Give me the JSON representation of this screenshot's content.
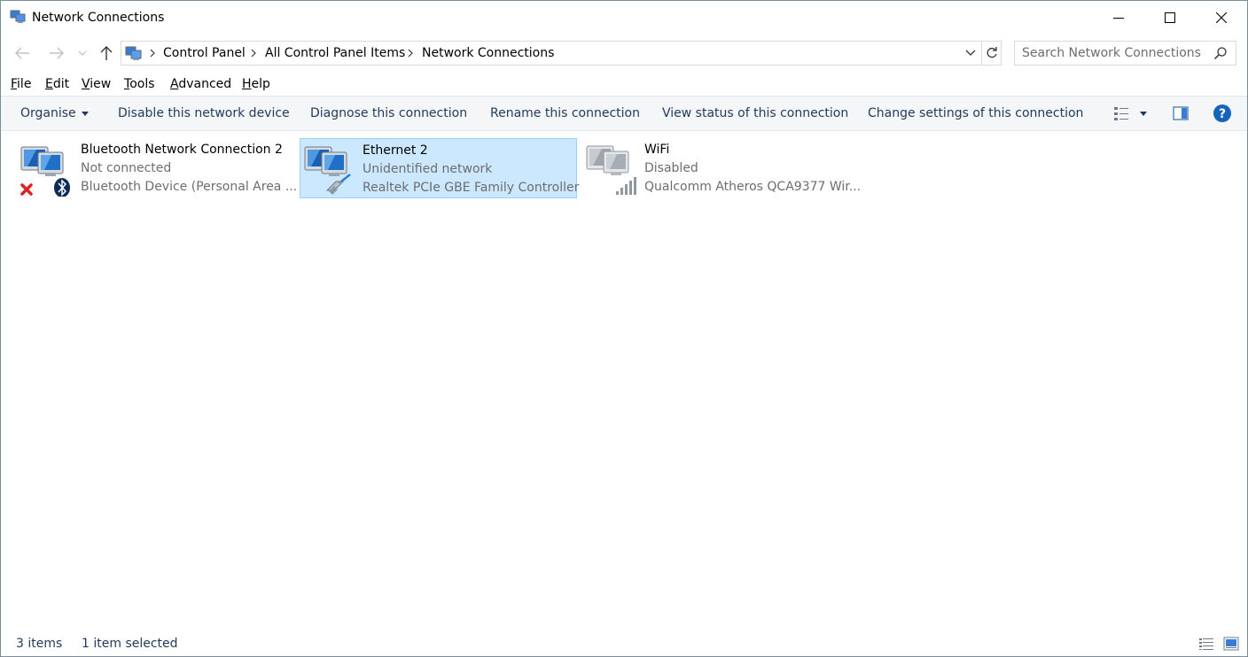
{
  "window": {
    "title": "Network Connections",
    "icon": "network-connections-icon"
  },
  "address": {
    "crumbs": [
      "Control Panel",
      "All Control Panel Items",
      "Network Connections"
    ]
  },
  "search": {
    "placeholder": "Search Network Connections"
  },
  "menu": {
    "items": [
      {
        "label": "File",
        "accel": "F",
        "rest": "ile"
      },
      {
        "label": "Edit",
        "accel": "E",
        "rest": "dit"
      },
      {
        "label": "View",
        "accel": "V",
        "rest": "iew"
      },
      {
        "label": "Tools",
        "accel": "T",
        "rest": "ools"
      },
      {
        "label": "Advanced",
        "accel": "A",
        "rest": "dvanced"
      },
      {
        "label": "Help",
        "accel": "H",
        "rest": "elp"
      }
    ]
  },
  "commands": {
    "organise": "Organise",
    "disable": "Disable this network device",
    "diagnose": "Diagnose this connection",
    "rename": "Rename this connection",
    "view_status": "View status of this connection",
    "change_settings": "Change settings of this connection"
  },
  "connections": [
    {
      "name": "Bluetooth Network Connection 2",
      "status": "Not connected",
      "device": "Bluetooth Device (Personal Area ...",
      "selected": false,
      "icon": "bluetooth-connection-icon"
    },
    {
      "name": "Ethernet 2",
      "status": "Unidentified network",
      "device": "Realtek PCIe GBE Family Controller",
      "selected": true,
      "icon": "ethernet-connection-icon"
    },
    {
      "name": "WiFi",
      "status": "Disabled",
      "device": "Qualcomm Atheros QCA9377 Wir...",
      "selected": false,
      "icon": "wifi-connection-icon"
    }
  ],
  "status": {
    "item_count": "3 items",
    "selection": "1 item selected"
  },
  "colors": {
    "selection_bg": "#cce8ff",
    "selection_border": "#99d1ff",
    "command_text": "#1e395b",
    "secondary_text": "#6d6d6d"
  }
}
